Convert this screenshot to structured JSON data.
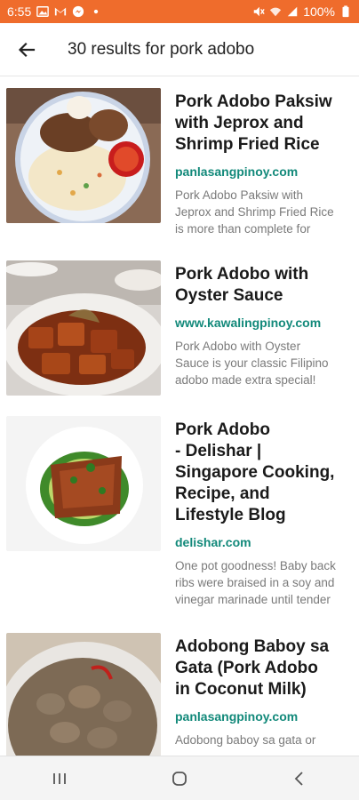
{
  "status_bar": {
    "time": "6:55",
    "battery": "100%",
    "left_icons": [
      "image-icon",
      "gmail-icon",
      "messenger-icon",
      "dot-icon"
    ],
    "right_icons": [
      "mute-icon",
      "wifi-icon",
      "signal-icon",
      "battery-icon"
    ],
    "background": "#ef6c2c"
  },
  "app_bar": {
    "title": "30 results for pork adobo",
    "back_icon": "arrow-back-icon"
  },
  "results": [
    {
      "title_lines": [
        "Pork Adobo Paksiw",
        "with Jeprox and",
        "Shrimp Fried Rice"
      ],
      "domain": "panlasangpinoy.com",
      "snippet_lines": [
        "Pork Adobo Paksiw with",
        "Jeprox and Shrimp Fried Rice",
        "is more than complete for"
      ]
    },
    {
      "title_lines": [
        "Pork Adobo with",
        "Oyster Sauce"
      ],
      "domain": "www.kawalingpinoy.com",
      "snippet_lines": [
        "Pork Adobo with Oyster",
        "Sauce is your classic Filipino",
        "adobo made extra special!"
      ]
    },
    {
      "title_lines": [
        "Pork Adobo",
        "- Delishar |",
        "Singapore Cooking,",
        "Recipe, and",
        "Lifestyle Blog"
      ],
      "domain": "delishar.com",
      "snippet_lines": [
        "One pot goodness! Baby back",
        "ribs were braised in a soy and",
        "vinegar marinade until tender"
      ]
    },
    {
      "title_lines": [
        "Adobong Baboy sa",
        "Gata (Pork Adobo",
        "in Coconut Milk)"
      ],
      "domain": "panlasangpinoy.com",
      "snippet_lines": [
        "Adobong baboy sa gata or"
      ]
    }
  ],
  "nav_bar": {
    "recents_icon": "recents-icon",
    "home_icon": "home-icon",
    "back_icon": "nav-back-icon"
  },
  "colors": {
    "accent": "#ef6c2c",
    "domain": "#12897a",
    "title": "#1a1a1a",
    "snippet": "#7a7a7a"
  }
}
